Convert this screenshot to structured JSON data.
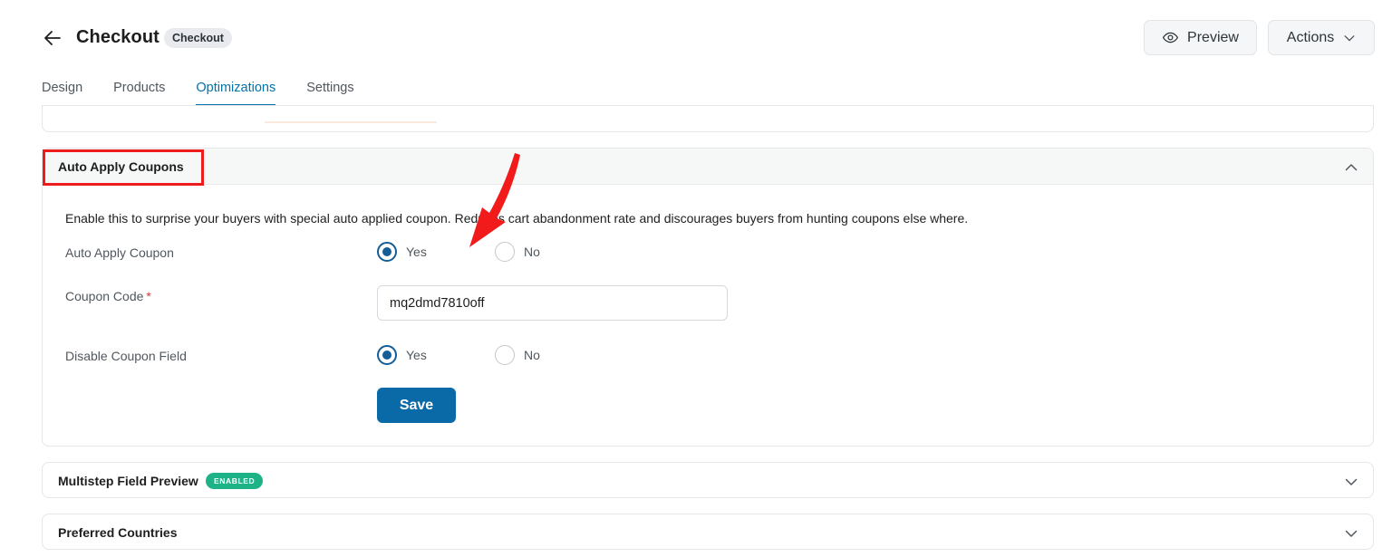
{
  "header": {
    "title": "Checkout",
    "badge": "Checkout",
    "preview_label": "Preview",
    "actions_label": "Actions"
  },
  "tabs": [
    {
      "label": "Design",
      "active": false
    },
    {
      "label": "Products",
      "active": false
    },
    {
      "label": "Optimizations",
      "active": true
    },
    {
      "label": "Settings",
      "active": false
    }
  ],
  "auto_apply": {
    "section_title": "Auto Apply Coupons",
    "expanded": true,
    "description": "Enable this to surprise your buyers with special auto applied coupon. Reduces cart abandonment rate and discourages buyers from hunting coupons else where.",
    "auto_apply_label": "Auto Apply Coupon",
    "auto_apply_options": [
      "Yes",
      "No"
    ],
    "auto_apply_selected": "Yes",
    "coupon_code_label": "Coupon Code",
    "coupon_code_required": "*",
    "coupon_code_value": "mq2dmd7810off",
    "disable_field_label": "Disable Coupon Field",
    "disable_field_options": [
      "Yes",
      "No"
    ],
    "disable_field_selected": "Yes",
    "save_label": "Save"
  },
  "multistep": {
    "section_title": "Multistep Field Preview",
    "badge": "ENABLED",
    "expanded": false
  },
  "preferred_countries": {
    "section_title": "Preferred Countries",
    "expanded": false
  },
  "colors": {
    "accent": "#0073aa",
    "save_button": "#0a69a7",
    "highlight": "#ee1c1c",
    "enabled_badge": "#1eb386"
  }
}
